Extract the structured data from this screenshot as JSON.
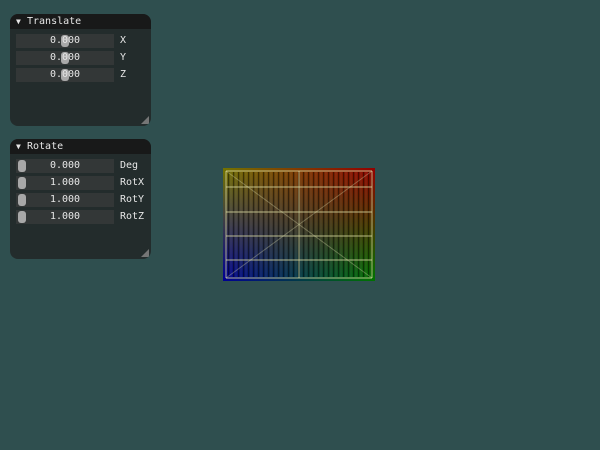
{
  "translate": {
    "title": "Translate",
    "collapse_glyph": "▼",
    "rows": [
      {
        "value": "0.000",
        "label": "X",
        "level": 0.5
      },
      {
        "value": "0.000",
        "label": "Y",
        "level": 0.5
      },
      {
        "value": "0.000",
        "label": "Z",
        "level": 0.5
      }
    ]
  },
  "rotate": {
    "title": "Rotate",
    "collapse_glyph": "▼",
    "rows": [
      {
        "value": "0.000",
        "label": "Deg",
        "level": 0.0
      },
      {
        "value": "1.000",
        "label": "RotX",
        "level": 0.0
      },
      {
        "value": "1.000",
        "label": "RotY",
        "level": 0.0
      },
      {
        "value": "1.000",
        "label": "RotZ",
        "level": 0.0
      }
    ]
  },
  "colors": {
    "background": "#2f4f4f",
    "corner_top_left": "#c8c800",
    "corner_top_right": "#ff0000",
    "corner_bottom_left": "#0000ff",
    "corner_bottom_right": "#00c800"
  },
  "icons": {
    "collapse": "collapse-triangle-icon",
    "resize": "resize-grip-icon"
  }
}
